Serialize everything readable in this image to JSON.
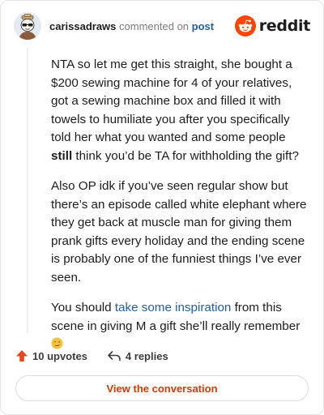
{
  "header": {
    "username": "carissadraws",
    "action": "commented on",
    "post_type": "post",
    "brand": "reddit"
  },
  "comment": {
    "p1_part1": "NTA so let me get this straight, she bought a $200 sewing machine for 4 of your relatives, got a sewing machine box and filled it with towels to humiliate you after you specifically told her what you wanted and some people ",
    "p1_bold": "still",
    "p1_part2": " think you’d be TA for withholding the gift?",
    "p2": "Also OP idk if you’ve seen regular show but there’s an episode called white elephant where they get back at muscle man for giving them prank gifts every holiday and the ending scene is probably one of the funniest things I’ve ever seen.",
    "p3_part1": "You should ",
    "p3_link": "take some inspiration",
    "p3_part2": " from this scene in giving M a gift she’ll really remember "
  },
  "stats": {
    "upvotes": "10 upvotes",
    "replies": "4 replies"
  },
  "cta": {
    "label": "View the conversation"
  },
  "icons": {
    "upvote": "upvote-arrow-icon",
    "reply": "reply-arrow-icon",
    "emoji": "winking-face-emoji",
    "brand": "reddit-snoo-icon"
  },
  "colors": {
    "accent": "#d93a00",
    "link": "#1f5fa8",
    "upvote": "#e8461f",
    "brand_orange": "#ff4500"
  }
}
